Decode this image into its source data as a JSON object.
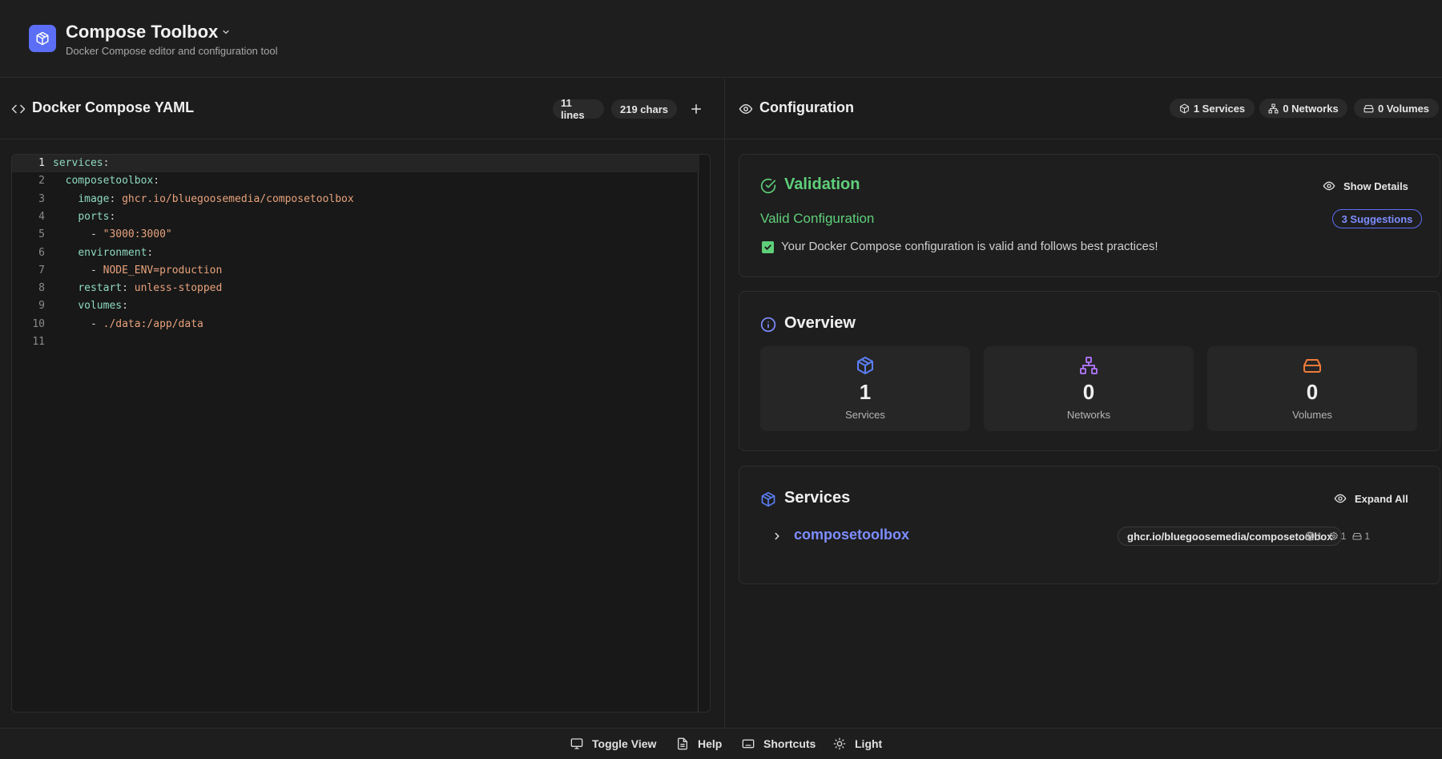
{
  "header": {
    "title": "Compose Toolbox",
    "subtitle": "Docker Compose editor and configuration tool"
  },
  "editor": {
    "title": "Docker Compose YAML",
    "lines_count": "11 lines",
    "chars_count": "219 chars",
    "active_line": 1,
    "code_lines": [
      {
        "num": "1",
        "segments": [
          {
            "text": "services",
            "cls": "k"
          },
          {
            "text": ":",
            "cls": "p"
          }
        ]
      },
      {
        "num": "2",
        "segments": [
          {
            "text": "  ",
            "cls": "p"
          },
          {
            "text": "composetoolbox",
            "cls": "k"
          },
          {
            "text": ":",
            "cls": "p"
          }
        ]
      },
      {
        "num": "3",
        "segments": [
          {
            "text": "    ",
            "cls": "p"
          },
          {
            "text": "image",
            "cls": "k"
          },
          {
            "text": ": ",
            "cls": "p"
          },
          {
            "text": "ghcr.io/bluegoosemedia/composetoolbox",
            "cls": "s"
          }
        ]
      },
      {
        "num": "4",
        "segments": [
          {
            "text": "    ",
            "cls": "p"
          },
          {
            "text": "ports",
            "cls": "k"
          },
          {
            "text": ":",
            "cls": "p"
          }
        ]
      },
      {
        "num": "5",
        "segments": [
          {
            "text": "      - ",
            "cls": "p"
          },
          {
            "text": "\"3000:3000\"",
            "cls": "s"
          }
        ]
      },
      {
        "num": "6",
        "segments": [
          {
            "text": "    ",
            "cls": "p"
          },
          {
            "text": "environment",
            "cls": "k"
          },
          {
            "text": ":",
            "cls": "p"
          }
        ]
      },
      {
        "num": "7",
        "segments": [
          {
            "text": "      - ",
            "cls": "p"
          },
          {
            "text": "NODE_ENV=production",
            "cls": "s"
          }
        ]
      },
      {
        "num": "8",
        "segments": [
          {
            "text": "    ",
            "cls": "p"
          },
          {
            "text": "restart",
            "cls": "k"
          },
          {
            "text": ": ",
            "cls": "p"
          },
          {
            "text": "unless-stopped",
            "cls": "s"
          }
        ]
      },
      {
        "num": "9",
        "segments": [
          {
            "text": "    ",
            "cls": "p"
          },
          {
            "text": "volumes",
            "cls": "k"
          },
          {
            "text": ":",
            "cls": "p"
          }
        ]
      },
      {
        "num": "10",
        "segments": [
          {
            "text": "      - ",
            "cls": "p"
          },
          {
            "text": "./data:/app/data",
            "cls": "s"
          }
        ]
      },
      {
        "num": "11",
        "segments": []
      }
    ]
  },
  "config": {
    "title": "Configuration",
    "services_pill": "1 Services",
    "networks_pill": "0 Networks",
    "volumes_pill": "0 Volumes"
  },
  "validation": {
    "title": "Validation",
    "show_details": "Show Details",
    "status": "Valid Configuration",
    "suggestions": "3 Suggestions",
    "message": "Your Docker Compose configuration is valid and follows best practices!"
  },
  "overview": {
    "title": "Overview",
    "services": {
      "count": "1",
      "label": "Services"
    },
    "networks": {
      "count": "0",
      "label": "Networks"
    },
    "volumes": {
      "count": "0",
      "label": "Volumes"
    }
  },
  "services": {
    "title": "Services",
    "expand_all": "Expand All",
    "items": [
      {
        "name": "composetoolbox",
        "image": "ghcr.io/bluegoosemedia/composetoolbox",
        "ports": "1",
        "env": "1",
        "volumes": "1"
      }
    ]
  },
  "footer": {
    "toggle_view": "Toggle View",
    "help": "Help",
    "shortcuts": "Shortcuts",
    "light": "Light"
  },
  "colors": {
    "accent": "#5b6ef5",
    "success": "#5fcf7a",
    "network": "#a970f0",
    "volume": "#f07a3a",
    "background": "#1c1c1c"
  }
}
